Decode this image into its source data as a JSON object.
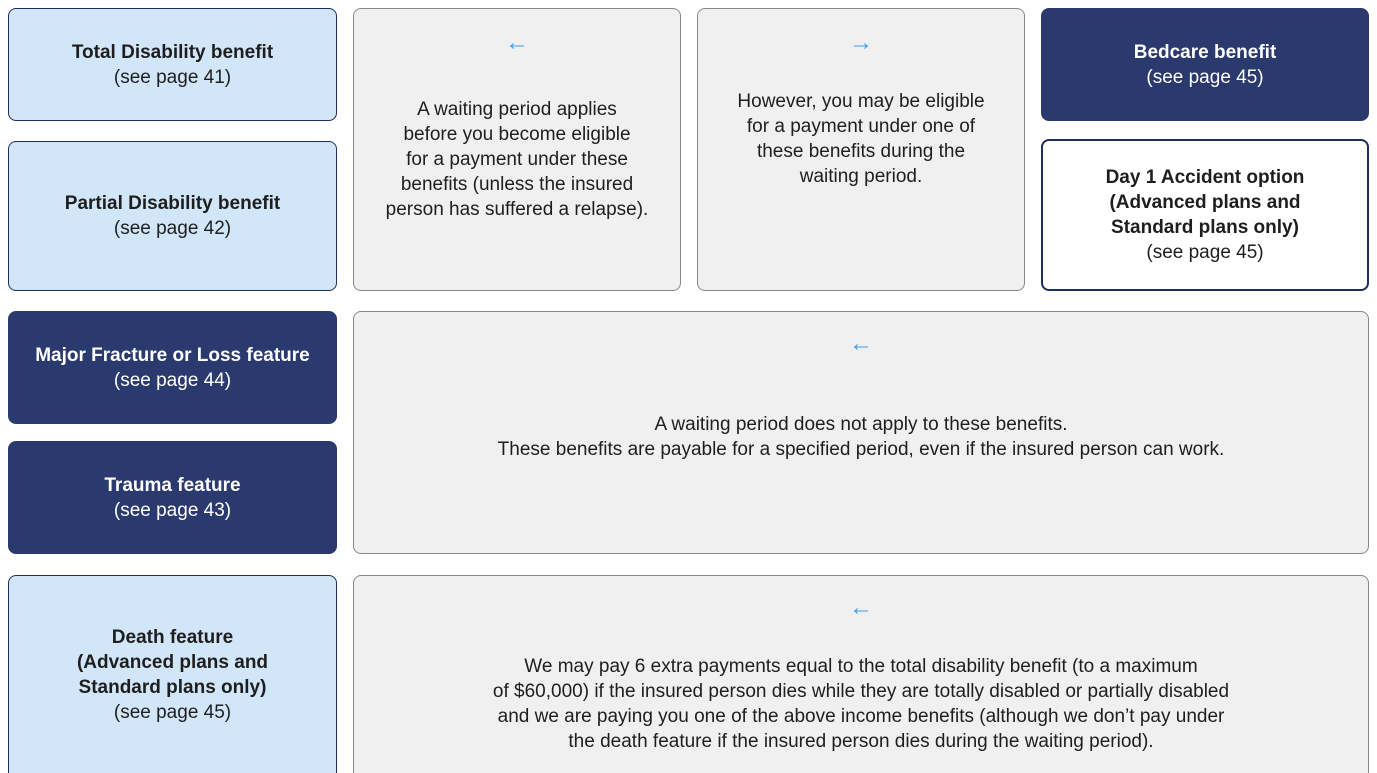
{
  "benefits": {
    "total_disability": {
      "title_lines": [
        "Total Disability benefit"
      ],
      "ref": "(see page 41)"
    },
    "partial_disability": {
      "title_lines": [
        "Partial Disability benefit"
      ],
      "ref": "(see page 42)"
    },
    "bedcare": {
      "title_lines": [
        "Bedcare benefit"
      ],
      "ref": "(see page 45)"
    },
    "day1_accident": {
      "title_lines": [
        "Day 1 Accident option",
        "(Advanced plans and",
        "Standard plans only)"
      ],
      "ref": "(see page 45)"
    },
    "major_fracture": {
      "title_lines": [
        "Major Fracture or Loss feature"
      ],
      "ref": "(see page 44)"
    },
    "trauma": {
      "title_lines": [
        "Trauma feature"
      ],
      "ref": "(see page 43)"
    },
    "death": {
      "title_lines": [
        "Death feature",
        "(Advanced plans and",
        "Standard plans only)"
      ],
      "ref": "(see page 45)"
    }
  },
  "notes": {
    "waiting_applies": {
      "arrow": "←",
      "lines": [
        "A waiting period applies",
        "before you become eligible",
        "for a payment under these",
        "benefits (unless the insured",
        "person has suffered a relapse)."
      ]
    },
    "eligible_during_wait": {
      "arrow": "→",
      "lines": [
        "However, you may be eligible",
        "for a payment under one of",
        "these benefits during the",
        "waiting period."
      ]
    },
    "no_waiting": {
      "arrow": "←",
      "lines": [
        "A waiting period does not apply to these benefits.",
        "These benefits are payable for a specified period, even if the insured person can work."
      ]
    },
    "death_payments": {
      "arrow": "←",
      "lines": [
        "We may pay 6 extra payments equal to the total disability benefit (to a maximum",
        "of $60,000) if the insured person dies while they are totally disabled or partially disabled",
        "and we are paying you one of the above income benefits (although we don’t pay under",
        "the death feature if the insured person dies during the waiting period)."
      ]
    }
  },
  "colors": {
    "light_blue": "#d2e6fa",
    "navy": "#2b3a6e",
    "note_gray": "#f0f0f0",
    "arrow_blue": "#3aa0e8"
  },
  "icons": {
    "left": "arrow-left-icon",
    "right": "arrow-right-icon"
  }
}
